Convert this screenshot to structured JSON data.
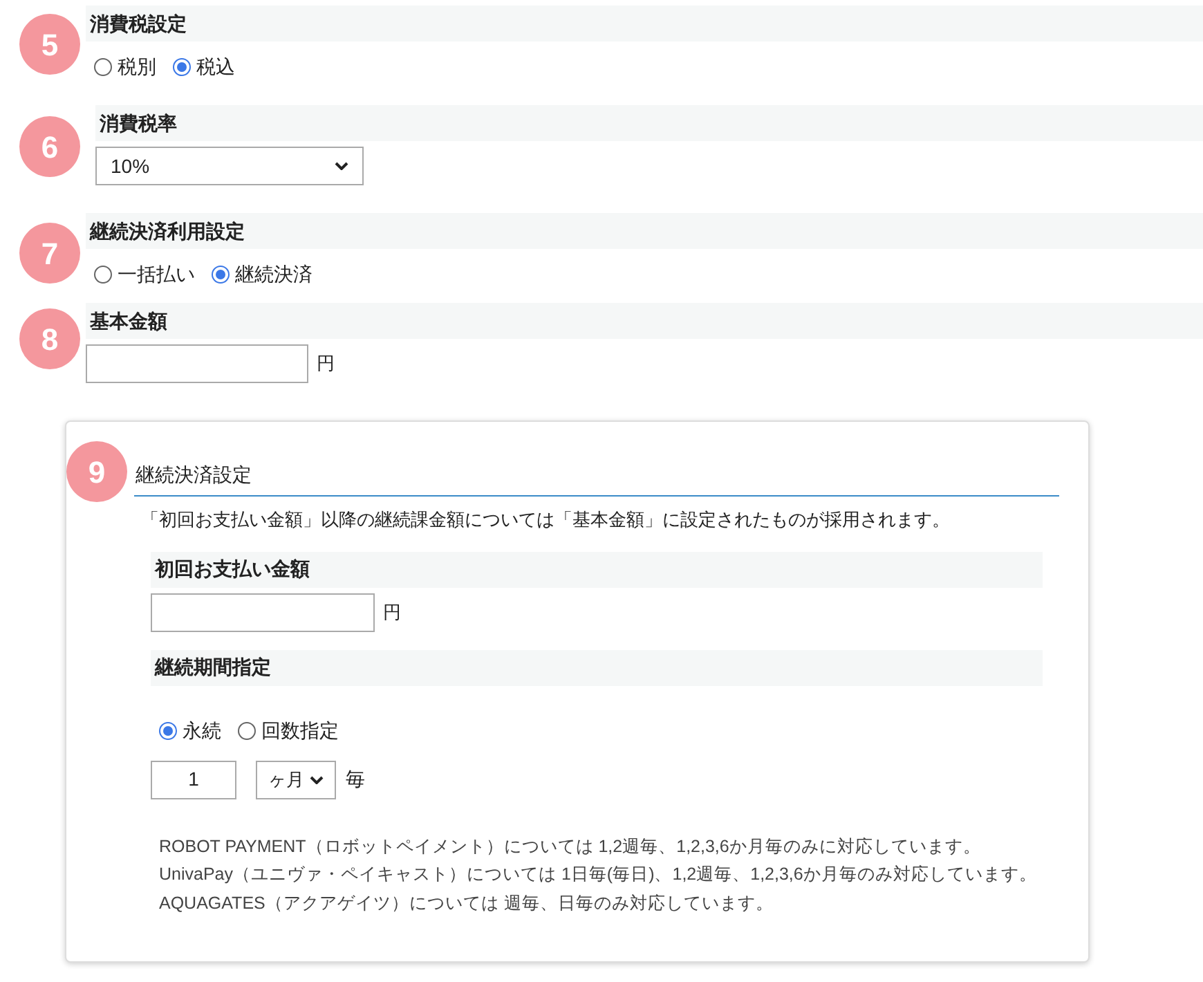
{
  "sections": [
    {
      "number": "5",
      "title": "消費税設定",
      "kind": "radios",
      "options": [
        {
          "label": "税別",
          "selected": false
        },
        {
          "label": "税込",
          "selected": true
        }
      ]
    },
    {
      "number": "6",
      "title": "消費税率",
      "kind": "select",
      "value": "10%"
    },
    {
      "number": "7",
      "title": "継続決済利用設定",
      "kind": "radios",
      "options": [
        {
          "label": "一括払い",
          "selected": false
        },
        {
          "label": "継続決済",
          "selected": true
        }
      ]
    },
    {
      "number": "8",
      "title": "基本金額",
      "kind": "amount",
      "unit": "円"
    }
  ],
  "continuation": {
    "number": "9",
    "title": "継続決済設定",
    "description": "「初回お支払い金額」以降の継続課金額については「基本金額」に設定されたものが採用されます。",
    "first_payment": {
      "title": "初回お支払い金額",
      "unit": "円"
    },
    "period": {
      "title": "継続期間指定",
      "options": [
        {
          "label": "永続",
          "selected": true
        },
        {
          "label": "回数指定",
          "selected": false
        }
      ],
      "count": "1",
      "interval": "ヶ月",
      "suffix": "毎"
    },
    "notes": [
      "ROBOT PAYMENT（ロボットペイメント）については 1,2週毎、1,2,3,6か月毎のみに対応しています。",
      "UnivaPay（ユニヴァ・ペイキャスト）については 1日毎(毎日)、1,2週毎、1,2,3,6か月毎のみ対応しています。",
      "AQUAGATES（アクアゲイツ）については 週毎、日毎のみ対応しています。"
    ]
  }
}
